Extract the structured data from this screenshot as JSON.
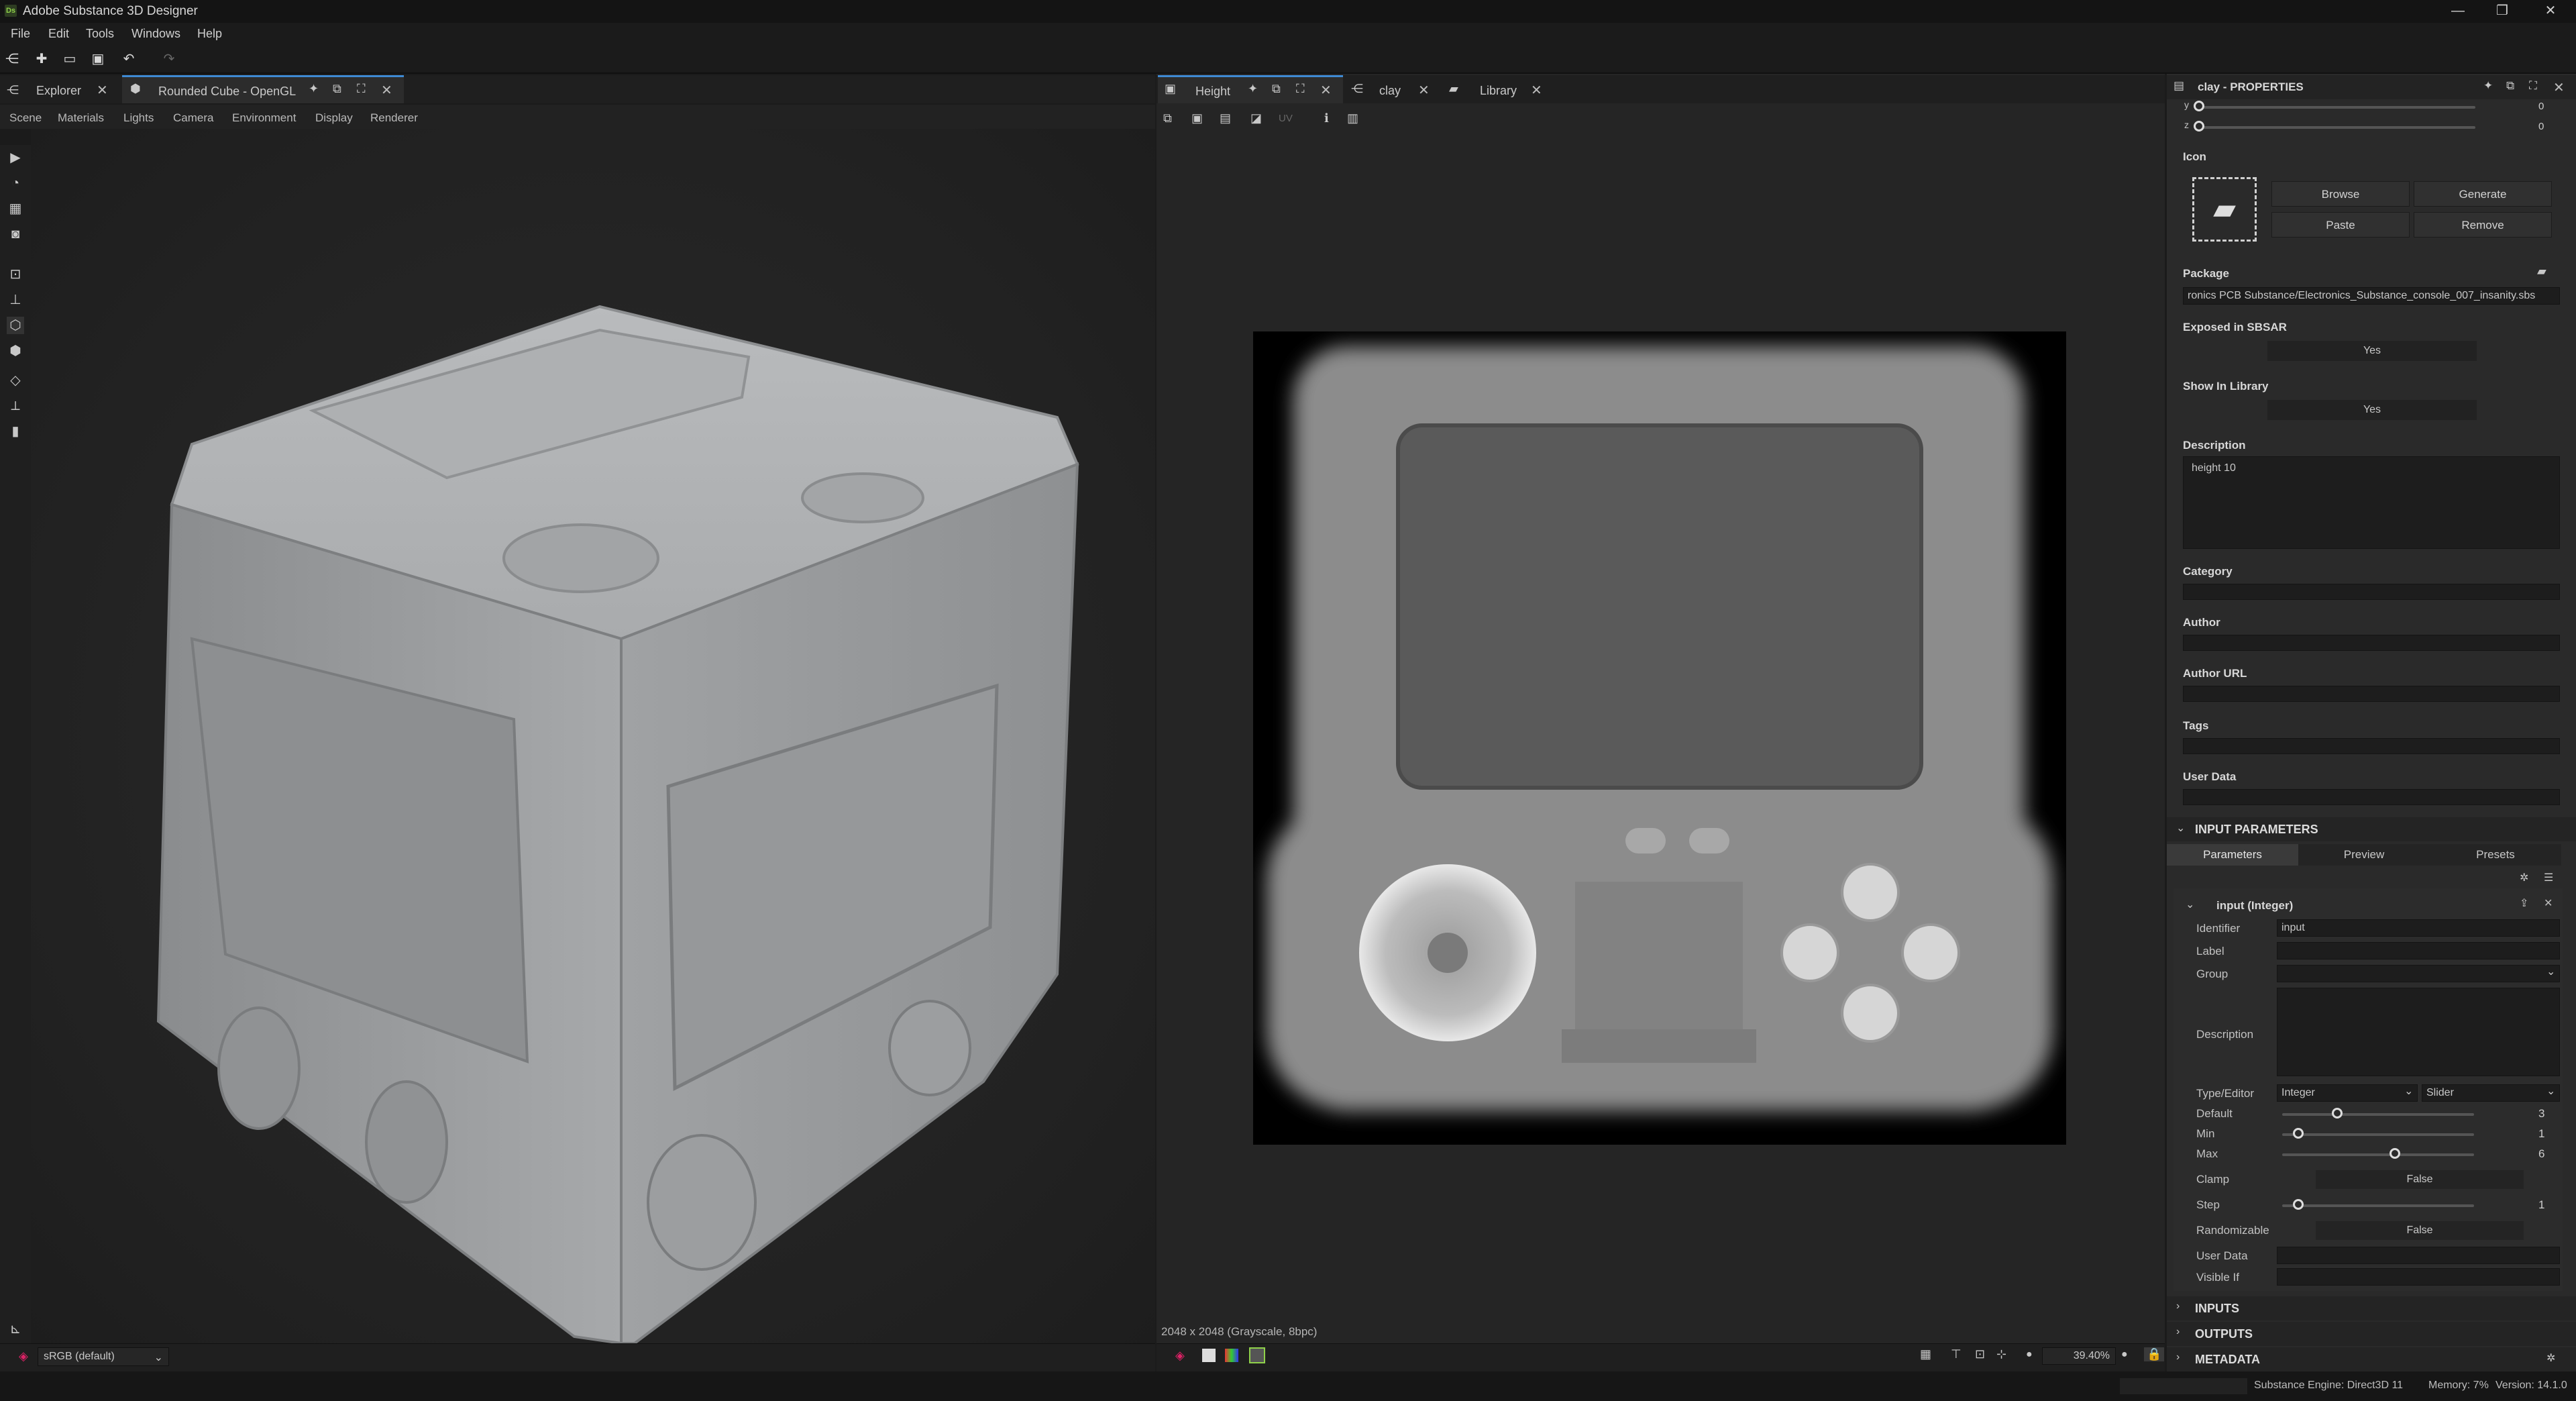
{
  "app": {
    "title": "Adobe Substance 3D Designer",
    "logo": "Ds"
  },
  "menu": [
    "File",
    "Edit",
    "Tools",
    "Windows",
    "Help"
  ],
  "left_tabs": [
    {
      "label": "Explorer"
    },
    {
      "label": "Rounded Cube - OpenGL"
    }
  ],
  "viewport_menu": [
    "Scene",
    "Materials",
    "Lights",
    "Camera",
    "Environment",
    "Display",
    "Renderer"
  ],
  "colorspace": "sRGB (default)",
  "mid_tabs": [
    {
      "label": "Height"
    },
    {
      "label": "clay"
    },
    {
      "label": "Library"
    }
  ],
  "uv_label": "UV",
  "image_info": "2048 x 2048 (Grayscale, 8bpc)",
  "zoom": "39.40%",
  "properties": {
    "title": "clay - PROPERTIES",
    "y_label": "y",
    "y_value": "0",
    "z_label": "z",
    "z_value": "0",
    "icon_label": "Icon",
    "browse": "Browse",
    "generate": "Generate",
    "paste": "Paste",
    "remove": "Remove",
    "package_label": "Package",
    "package_value": "ronics PCB Substance/Electronics_Substance_console_007_insanity.sbs",
    "exposed_label": "Exposed in SBSAR",
    "exposed_value": "Yes",
    "show_label": "Show In Library",
    "show_value": "Yes",
    "description_label": "Description",
    "description_value": "height 10",
    "category_label": "Category",
    "author_label": "Author",
    "author_url_label": "Author URL",
    "tags_label": "Tags",
    "user_data_label": "User Data"
  },
  "input_params": {
    "section": "INPUT PARAMETERS",
    "tabs": [
      "Parameters",
      "Preview",
      "Presets"
    ],
    "item_title": "input (Integer)",
    "identifier_label": "Identifier",
    "identifier_value": "input",
    "label_label": "Label",
    "group_label": "Group",
    "description_label": "Description",
    "type_label": "Type/Editor",
    "type_value": "Integer",
    "editor_value": "Slider",
    "default_label": "Default",
    "default_value": "3",
    "min_label": "Min",
    "min_value": "1",
    "max_label": "Max",
    "max_value": "6",
    "clamp_label": "Clamp",
    "clamp_value": "False",
    "step_label": "Step",
    "step_value": "1",
    "random_label": "Randomizable",
    "random_value": "False",
    "userdata_label": "User Data",
    "visible_label": "Visible If"
  },
  "sections": [
    "INPUTS",
    "OUTPUTS",
    "METADATA"
  ],
  "status": {
    "engine": "Substance Engine: Direct3D 11",
    "memory": "Memory: 7%",
    "version": "Version: 14.1.0"
  }
}
